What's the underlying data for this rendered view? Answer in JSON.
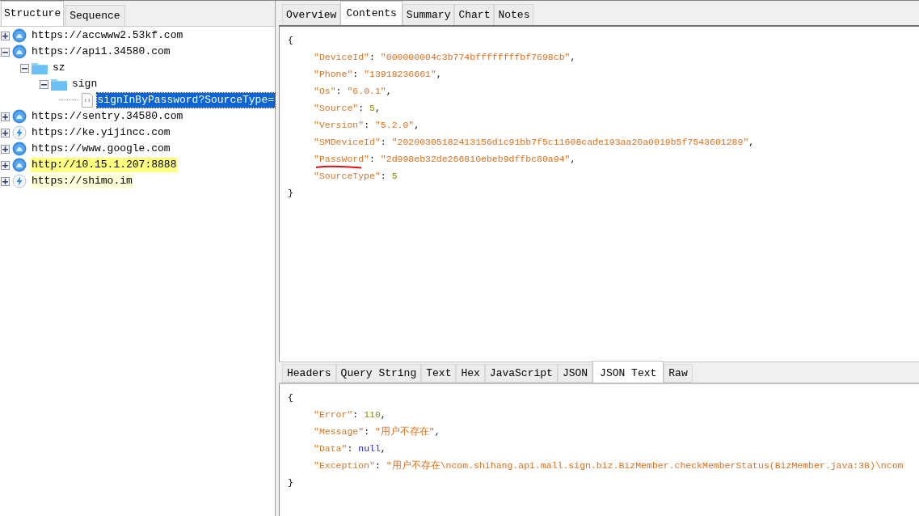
{
  "left_tabs": [
    {
      "label": "Structure",
      "selected": true
    },
    {
      "label": "Sequence",
      "selected": false
    }
  ],
  "tree": [
    {
      "label": "https://accwww2.53kf.com",
      "kind": "globe",
      "expanded": false
    },
    {
      "label": "https://api1.34580.com",
      "kind": "globe",
      "expanded": true,
      "children": [
        {
          "label": "sz",
          "kind": "folder",
          "expanded": true,
          "children": [
            {
              "label": "sign",
              "kind": "folder",
              "expanded": true,
              "children": [
                {
                  "label": "signInByPassword?SourceType=",
                  "kind": "file",
                  "selected": true
                }
              ]
            }
          ]
        }
      ]
    },
    {
      "label": "https://sentry.34580.com",
      "kind": "globe",
      "expanded": false
    },
    {
      "label": "https://ke.yijincc.com",
      "kind": "bolt",
      "expanded": false
    },
    {
      "label": "https://www.google.com",
      "kind": "globe",
      "expanded": false
    },
    {
      "label": "http://10.15.1.207:8888",
      "kind": "globe",
      "expanded": false,
      "color": "#ffff80"
    },
    {
      "label": "https://shimo.im",
      "kind": "bolt",
      "expanded": false,
      "color": "#ffffd8"
    }
  ],
  "top_tabs": [
    {
      "label": "Overview",
      "selected": false
    },
    {
      "label": "Contents",
      "selected": true
    },
    {
      "label": "Summary",
      "selected": false
    },
    {
      "label": "Chart",
      "selected": false
    },
    {
      "label": "Notes",
      "selected": false
    }
  ],
  "request_body": [
    [
      {
        "text": "{",
        "kind": "punct"
      }
    ],
    [
      {
        "text": "\"DeviceId\"",
        "kind": "key"
      },
      {
        "text": ": ",
        "kind": "punct"
      },
      {
        "text": "\"000000004c3b774bffffffffbf7698cb\"",
        "kind": "string"
      },
      {
        "text": ",",
        "kind": "punct"
      }
    ],
    [
      {
        "text": "\"Phone\"",
        "kind": "key"
      },
      {
        "text": ": ",
        "kind": "punct"
      },
      {
        "text": "\"13918236661\"",
        "kind": "string"
      },
      {
        "text": ",",
        "kind": "punct"
      }
    ],
    [
      {
        "text": "\"Os\"",
        "kind": "key"
      },
      {
        "text": ": ",
        "kind": "punct"
      },
      {
        "text": "\"6.0.1\"",
        "kind": "string"
      },
      {
        "text": ",",
        "kind": "punct"
      }
    ],
    [
      {
        "text": "\"Source\"",
        "kind": "key"
      },
      {
        "text": ": ",
        "kind": "punct"
      },
      {
        "text": "5",
        "kind": "number"
      },
      {
        "text": ",",
        "kind": "punct"
      }
    ],
    [
      {
        "text": "\"Version\"",
        "kind": "key"
      },
      {
        "text": ": ",
        "kind": "punct"
      },
      {
        "text": "\"5.2.0\"",
        "kind": "string"
      },
      {
        "text": ",",
        "kind": "punct"
      }
    ],
    [
      {
        "text": "\"SMDeviceId\"",
        "kind": "key"
      },
      {
        "text": ": ",
        "kind": "punct"
      },
      {
        "text": "\"20200305182413156d1c91bb7f5c11608cade193aa20a0019b5f7543601289\"",
        "kind": "string"
      },
      {
        "text": ",",
        "kind": "punct"
      }
    ],
    [
      {
        "text": "\"PassWord\"",
        "kind": "key",
        "underlined": true
      },
      {
        "text": ": ",
        "kind": "punct"
      },
      {
        "text": "\"2d998eb32de266810ebeb9dffbc80a94\"",
        "kind": "string"
      },
      {
        "text": ",",
        "kind": "punct"
      }
    ],
    [
      {
        "text": "\"SourceType\"",
        "kind": "key"
      },
      {
        "text": ": ",
        "kind": "punct"
      },
      {
        "text": "5",
        "kind": "number"
      }
    ],
    [
      {
        "text": "}",
        "kind": "punct"
      }
    ]
  ],
  "bottom_tabs": [
    {
      "label": "Headers",
      "selected": false
    },
    {
      "label": "Query String",
      "selected": false
    },
    {
      "label": "Text",
      "selected": false
    },
    {
      "label": "Hex",
      "selected": false
    },
    {
      "label": "JavaScript",
      "selected": false
    },
    {
      "label": "JSON",
      "selected": false
    },
    {
      "label": "JSON Text",
      "selected": true
    },
    {
      "label": "Raw",
      "selected": false
    }
  ],
  "response_body": [
    [
      {
        "text": "{",
        "kind": "punct"
      }
    ],
    [
      {
        "text": "\"Error\"",
        "kind": "key"
      },
      {
        "text": ": ",
        "kind": "punct"
      },
      {
        "text": "110",
        "kind": "number"
      },
      {
        "text": ",",
        "kind": "punct"
      }
    ],
    [
      {
        "text": "\"Message\"",
        "kind": "key"
      },
      {
        "text": ": ",
        "kind": "punct"
      },
      {
        "text": "\"用户不存在\"",
        "kind": "string"
      },
      {
        "text": ",",
        "kind": "punct"
      }
    ],
    [
      {
        "text": "\"Data\"",
        "kind": "key"
      },
      {
        "text": ": ",
        "kind": "punct"
      },
      {
        "text": "null",
        "kind": "null"
      },
      {
        "text": ",",
        "kind": "punct"
      }
    ],
    [
      {
        "text": "\"Exception\"",
        "kind": "key"
      },
      {
        "text": ": ",
        "kind": "punct"
      },
      {
        "text": "\"用户不存在\\ncom.shihang.api.mall.sign.biz.BizMember.checkMemberStatus(BizMember.java:38)\\ncom",
        "kind": "string"
      }
    ],
    [
      {
        "text": "}",
        "kind": "punct"
      }
    ]
  ]
}
